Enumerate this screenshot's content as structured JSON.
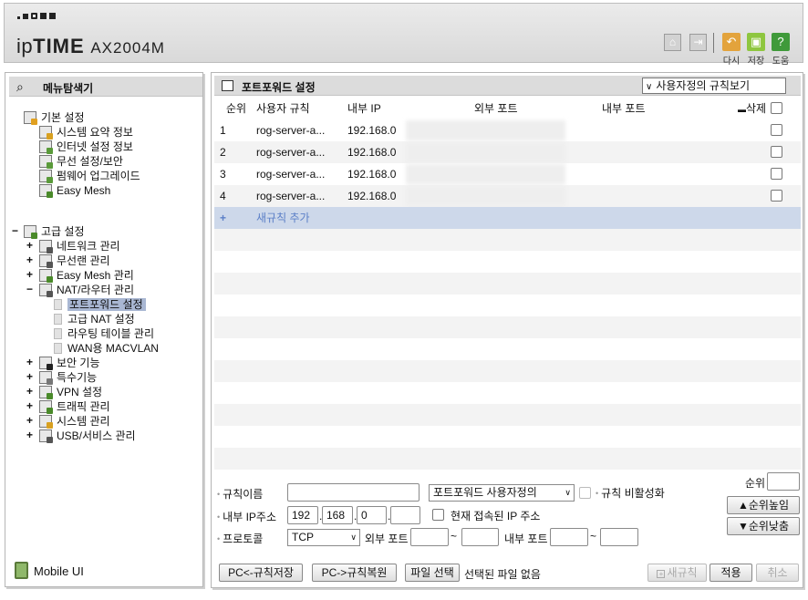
{
  "header": {
    "brand_prefix": "ip",
    "brand_bold": "TIME",
    "model": "AX2004M",
    "actions": [
      {
        "label": "다시",
        "icon": "undo-icon",
        "color": "#e3a33c"
      },
      {
        "label": "저장",
        "icon": "save-icon",
        "color": "#8ec63f"
      },
      {
        "label": "도움",
        "icon": "help-icon",
        "color": "#3f9a3a"
      }
    ]
  },
  "sidebar": {
    "title": "메뉴탐색기",
    "basic": {
      "label": "기본 설정",
      "items": [
        "시스템 요약 정보",
        "인터넷 설정 정보",
        "무선 설정/보안",
        "펌웨어 업그레이드",
        "Easy Mesh"
      ]
    },
    "advanced": {
      "label": "고급 설정",
      "items": [
        "네트워크 관리",
        "무선랜 관리",
        "Easy Mesh 관리",
        "NAT/라우터 관리"
      ],
      "nat_children": [
        "포트포워드 설정",
        "고급 NAT 설정",
        "라우팅 테이블 관리",
        "WAN용 MACVLAN"
      ],
      "more_items": [
        "보안 기능",
        "특수기능",
        "VPN 설정",
        "트래픽 관리",
        "시스템 관리",
        "USB/서비스 관리"
      ]
    },
    "mobile_label": "Mobile UI"
  },
  "main": {
    "title": "포트포워드 설정",
    "view_select": "사용자정의 규칙보기",
    "columns": {
      "order": "순위",
      "rule": "사용자 규칙",
      "internal_ip": "내부 IP",
      "external_port": "외부 포트",
      "internal_port": "내부 포트",
      "delete": "삭제"
    },
    "rows": [
      {
        "order": "1",
        "rule": "rog-server-a...",
        "ip": "192.168.0"
      },
      {
        "order": "2",
        "rule": "rog-server-a...",
        "ip": "192.168.0"
      },
      {
        "order": "3",
        "rule": "rog-server-a...",
        "ip": "192.168.0"
      },
      {
        "order": "4",
        "rule": "rog-server-a...",
        "ip": "192.168.0"
      }
    ],
    "add_plus": "+",
    "add_label": "새규칙 추가"
  },
  "form": {
    "rule_name_label": "규칙이름",
    "rule_name_value": "",
    "type_select": "포트포워드 사용자정의",
    "disable_label": "규칙 비활성화",
    "order_label": "순위",
    "order_value": "",
    "ip_label": "내부 IP주소",
    "ip1": "192",
    "ip2": "168",
    "ip3": "0",
    "ip4": "",
    "current_ip_label": "현재 접속된 IP 주소",
    "protocol_label": "프로토콜",
    "protocol_value": "TCP",
    "ext_port_label": "외부 포트",
    "int_port_label": "내부 포트",
    "tilde": "~",
    "up_button": "▲순위높임",
    "down_button": "▼순위낮춤",
    "pc_save": "PC<-규칙저장",
    "pc_restore": "PC->규칙복원",
    "file_select": "파일 선택",
    "file_status": "선택된 파일 없음",
    "new_rule": "새규칙",
    "apply": "적용",
    "cancel": "취소"
  }
}
